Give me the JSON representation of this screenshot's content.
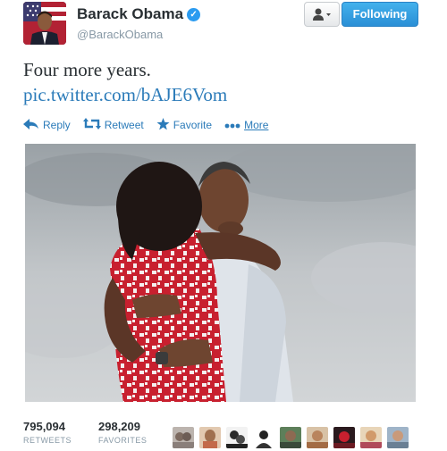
{
  "tweet": {
    "author_name": "Barack Obama",
    "author_handle": "@BarackObama",
    "verified_icon": "verified-badge-icon",
    "text": "Four more years.",
    "link_text": "pic.twitter.com/bAJE6Vom"
  },
  "header": {
    "user_menu_icon": "user-icon",
    "follow_button_label": "Following",
    "follow_button_color": "#2a8fd6"
  },
  "actions": [
    {
      "id": "reply",
      "label": "Reply",
      "icon": "reply-arrow-icon"
    },
    {
      "id": "retweet",
      "label": "Retweet",
      "icon": "retweet-icon"
    },
    {
      "id": "favorite",
      "label": "Favorite",
      "icon": "star-icon"
    },
    {
      "id": "more",
      "label": "More",
      "icon": "ellipsis-icon"
    }
  ],
  "stats": {
    "retweets_count": "795,094",
    "retweets_label": "RETWEETS",
    "favorites_count": "298,209",
    "favorites_label": "FAVORITES"
  },
  "favoriter_avatars_count": 9,
  "colors": {
    "link": "#2b7bb9",
    "text": "#292f33",
    "muted": "#8899a6"
  }
}
